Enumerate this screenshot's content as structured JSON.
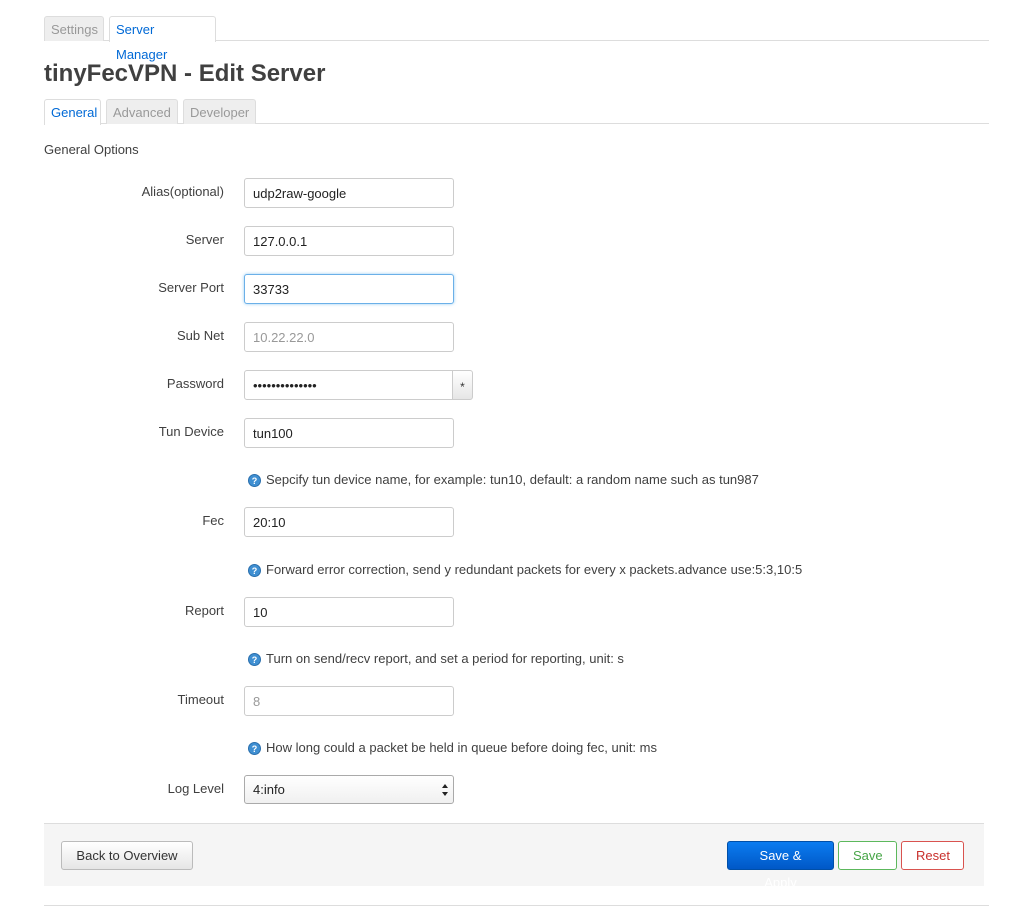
{
  "top_tabs": [
    {
      "label": "Settings",
      "active": false
    },
    {
      "label": "Server Manager",
      "active": true
    }
  ],
  "page_title": "tinyFecVPN - Edit Server",
  "sub_tabs": [
    {
      "label": "General",
      "active": true
    },
    {
      "label": "Advanced",
      "active": false
    },
    {
      "label": "Developer",
      "active": false
    }
  ],
  "section_title": "General Options",
  "fields": {
    "alias": {
      "label": "Alias(optional)",
      "value": "udp2raw-google",
      "placeholder": ""
    },
    "server": {
      "label": "Server",
      "value": "127.0.0.1",
      "placeholder": ""
    },
    "server_port": {
      "label": "Server Port",
      "value": "33733",
      "placeholder": ""
    },
    "subnet": {
      "label": "Sub Net",
      "value": "",
      "placeholder": "10.22.22.0"
    },
    "password": {
      "label": "Password",
      "value": "••••••••••••••",
      "toggle": "*"
    },
    "tun_device": {
      "label": "Tun Device",
      "value": "tun100",
      "placeholder": "",
      "hint": "Sepcify tun device name, for example: tun10, default: a random name such as tun987"
    },
    "fec": {
      "label": "Fec",
      "value": "20:10",
      "placeholder": "",
      "hint": "Forward error correction, send y redundant packets for every x packets.advance use:5:3,10:5"
    },
    "report": {
      "label": "Report",
      "value": "10",
      "placeholder": "",
      "hint": "Turn on send/recv report, and set a period for reporting, unit: s"
    },
    "timeout": {
      "label": "Timeout",
      "value": "",
      "placeholder": "8",
      "hint": "How long could a packet be held in queue before doing fec, unit: ms"
    },
    "log_level": {
      "label": "Log Level",
      "value": "4:info"
    }
  },
  "footer": {
    "back_label": "Back to Overview",
    "save_apply_label": "Save & Apply",
    "save_label": "Save",
    "reset_label": "Reset"
  },
  "colors": {
    "accent": "#0069d6",
    "primary_button": "#0058c7",
    "save_green": "#46a546",
    "reset_red": "#c9302c"
  }
}
